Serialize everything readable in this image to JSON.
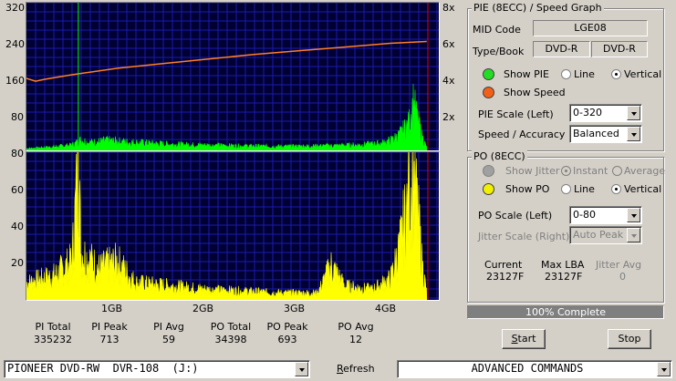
{
  "chart_data": [
    {
      "type": "area",
      "name_top": "PIE graph",
      "y_left_ticks": [
        "320",
        "240",
        "160",
        "80"
      ],
      "y_left_range": [
        0,
        320
      ],
      "y_right_ticks": [
        "8x",
        "6x",
        "4x",
        "2x"
      ],
      "y_right_range": [
        0,
        8
      ],
      "x_range_gb": [
        0,
        4.4
      ],
      "series": [
        {
          "name": "PIE",
          "color": "#00ff00",
          "x_gb": [
            0,
            0.3,
            0.5,
            0.57,
            0.6,
            0.7,
            0.9,
            1.2,
            1.6,
            2.0,
            2.4,
            2.8,
            3.2,
            3.6,
            3.9,
            4.0,
            4.1,
            4.2,
            4.25,
            4.3,
            4.35,
            4.4
          ],
          "values": [
            4,
            8,
            12,
            20,
            24,
            18,
            22,
            18,
            14,
            12,
            10,
            9,
            10,
            12,
            16,
            22,
            35,
            60,
            110,
            68,
            30,
            6
          ]
        },
        {
          "name": "Speed",
          "color": "#ff7f27",
          "x_gb": [
            0,
            0.1,
            0.2,
            0.5,
            1.0,
            1.5,
            2.0,
            2.5,
            3.0,
            3.5,
            4.0,
            4.4
          ],
          "values": [
            3.9,
            3.75,
            3.85,
            4.1,
            4.45,
            4.7,
            4.95,
            5.2,
            5.4,
            5.6,
            5.8,
            5.9
          ]
        }
      ]
    },
    {
      "type": "area",
      "name_bottom": "PO graph",
      "y_ticks": [
        "80",
        "60",
        "40",
        "20"
      ],
      "y_range": [
        0,
        80
      ],
      "x_ticks": [
        "1GB",
        "2GB",
        "3GB",
        "4GB"
      ],
      "x_range_gb": [
        0,
        4.4
      ],
      "series": [
        {
          "name": "PO",
          "color": "#ffff00",
          "x_gb": [
            0,
            0.3,
            0.5,
            0.57,
            0.6,
            0.8,
            1.0,
            1.2,
            1.6,
            2.0,
            2.4,
            2.8,
            3.2,
            3.35,
            3.5,
            3.8,
            4.0,
            4.1,
            4.2,
            4.25,
            4.3,
            4.35,
            4.4
          ],
          "values": [
            10,
            14,
            22,
            80,
            28,
            18,
            22,
            10,
            8,
            6,
            5,
            4,
            4,
            20,
            8,
            6,
            12,
            30,
            58,
            75,
            50,
            20,
            4
          ]
        }
      ]
    }
  ],
  "stats": [
    {
      "label": "PI Total",
      "value": "335232"
    },
    {
      "label": "PI Peak",
      "value": "713"
    },
    {
      "label": "PI Avg",
      "value": "59"
    },
    {
      "label": "PO Total",
      "value": "34398"
    },
    {
      "label": "PO Peak",
      "value": "693"
    },
    {
      "label": "PO Avg",
      "value": "12"
    }
  ],
  "pie_panel": {
    "title": "PIE (8ECC) / Speed Graph",
    "mid_code_label": "MID Code",
    "mid_code_value": "LGE08",
    "type_book_label": "Type/Book",
    "type_value": "DVD-R",
    "book_value": "DVD-R",
    "show_pie_label": "Show PIE",
    "show_speed_label": "Show Speed",
    "line_label": "Line",
    "vertical_label": "Vertical",
    "pie_scale_label": "PIE Scale (Left)",
    "pie_scale_value": "0-320",
    "speed_accuracy_label": "Speed / Accuracy",
    "speed_accuracy_value": "Balanced",
    "pie_led_color": "#22dd22",
    "speed_led_color": "#f06018"
  },
  "po_panel": {
    "title": "PO (8ECC)",
    "show_jitter_label": "Show Jitter",
    "instant_label": "Instant",
    "average_label": "Average",
    "show_po_label": "Show PO",
    "line_label": "Line",
    "vertical_label": "Vertical",
    "po_scale_label": "PO Scale (Left)",
    "po_scale_value": "0-80",
    "jitter_scale_label": "Jitter Scale (Right)",
    "jitter_scale_value": "Auto Peak",
    "current_label": "Current",
    "current_value": "23127F",
    "max_lba_label": "Max LBA",
    "max_lba_value": "23127F",
    "jitter_avg_label": "Jitter Avg",
    "jitter_avg_value": "0",
    "po_led_color": "#f0f000"
  },
  "progress_text": "100% Complete",
  "progress_fraction": 1.0,
  "start_label": "Start",
  "stop_label": "Stop",
  "drive_value": "PIONEER DVD-RW  DVR-108  (J:)",
  "refresh_label": "Refresh",
  "commands_value": "ADVANCED COMMANDS"
}
